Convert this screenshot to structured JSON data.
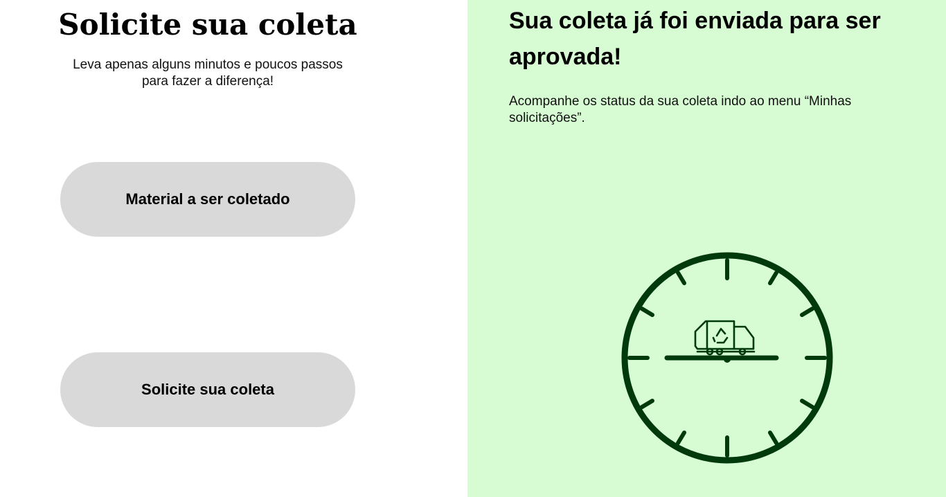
{
  "request": {
    "title": "Solicite sua coleta",
    "subtitle": "Leva apenas alguns minutos e poucos passos para fazer a diferença!",
    "buttons": {
      "material_label": "Material a ser coletado",
      "solicite_label": "Solicite sua coleta"
    }
  },
  "confirmation": {
    "title": "Sua coleta já foi enviada para ser aprovada!",
    "message": "Acompanhe os status da sua coleta indo ao menu “Minhas solicitações”.",
    "illustration": "clock-with-recycling-truck-icon"
  },
  "colors": {
    "panel_background": "#d7fbd3",
    "button_background": "#d9d9d9",
    "clock_green": "#003a0c"
  }
}
